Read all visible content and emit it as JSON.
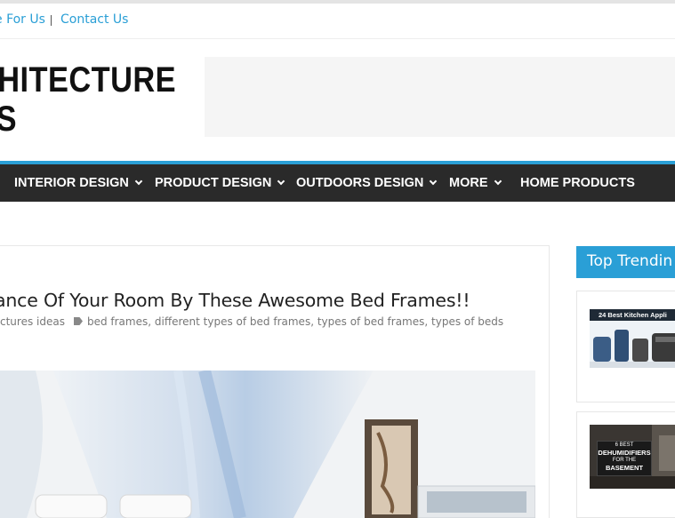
{
  "top_links": {
    "write_for_us": "e For Us",
    "contact_us": "Contact Us"
  },
  "logo": {
    "line1": "CHITECTURE",
    "line2": "EAS"
  },
  "nav": {
    "items": [
      {
        "label": "INTERIOR DESIGN",
        "has_dropdown": true
      },
      {
        "label": "PRODUCT DESIGN",
        "has_dropdown": true
      },
      {
        "label": "OUTDOORS DESIGN",
        "has_dropdown": true
      },
      {
        "label": "MORE",
        "has_dropdown": true
      },
      {
        "label": "HOME PRODUCTS",
        "has_dropdown": false
      }
    ]
  },
  "article": {
    "title": "ance Of Your Room By These Awesome Bed Frames!!",
    "category": "ctures ideas",
    "tags": [
      "bed frames",
      "different types of bed frames",
      "types of bed frames",
      "types of beds"
    ]
  },
  "sidebar": {
    "heading": "Top Trendin",
    "cards": [
      {
        "thumb_text": "24 Best Kitchen Appli"
      },
      {
        "thumb_small_top": "6 BEST",
        "thumb_big": "DEHUMIDIFIERS",
        "thumb_small_mid": "FOR THE",
        "thumb_big2": "BASEMENT"
      }
    ]
  },
  "colors": {
    "accent": "#2a9fd6",
    "nav_bg": "#2a2a2a",
    "link": "#2a9fd6"
  }
}
